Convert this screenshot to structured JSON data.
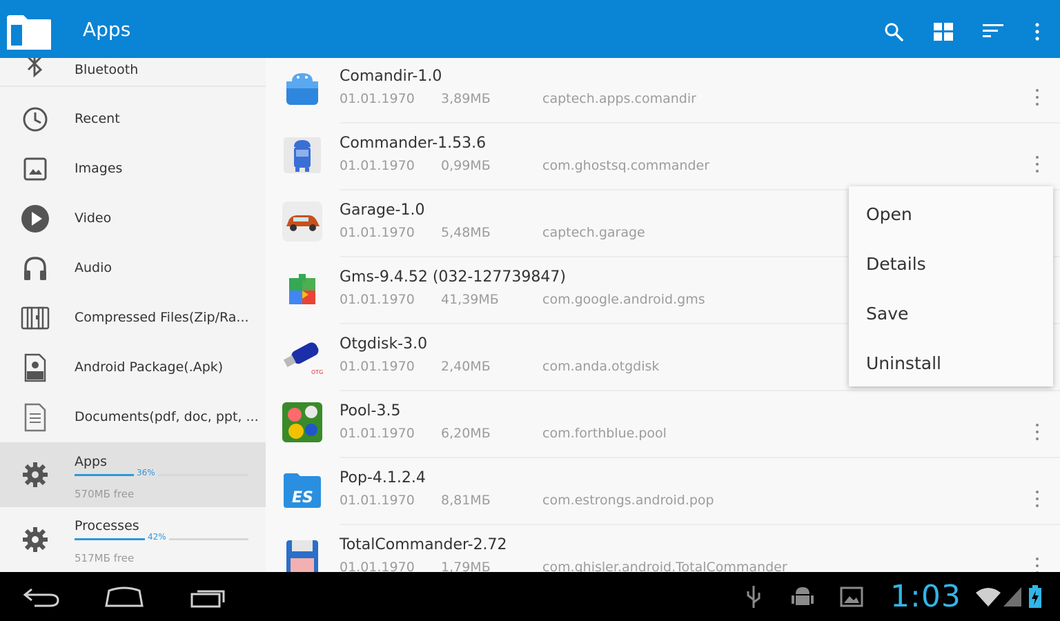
{
  "appbar": {
    "title": "Apps",
    "actions": [
      "search-icon",
      "grid-view-icon",
      "sort-icon",
      "overflow-menu-icon"
    ],
    "color": "#0a84d4"
  },
  "sidebar": {
    "items": [
      {
        "label": "Bluetooth",
        "icon": "bluetooth-icon"
      },
      {
        "label": "Recent",
        "icon": "clock-icon"
      },
      {
        "label": "Images",
        "icon": "image-icon"
      },
      {
        "label": "Video",
        "icon": "play-icon"
      },
      {
        "label": "Audio",
        "icon": "headphones-icon"
      },
      {
        "label": "Compressed Files(Zip/Ra...",
        "icon": "archive-icon"
      },
      {
        "label": "Android Package(.Apk)",
        "icon": "apk-file-icon"
      },
      {
        "label": "Documents(pdf, doc, ppt, ...",
        "icon": "document-icon"
      },
      {
        "label": "Apps",
        "icon": "gear-icon",
        "usage_percent": "36%",
        "usage_value": 0.36,
        "free": "570МБ free",
        "selected": true
      },
      {
        "label": "Processes",
        "icon": "gear-icon",
        "usage_percent": "42%",
        "usage_value": 0.42,
        "free": "517МБ free"
      }
    ]
  },
  "apps": [
    {
      "name": "Comandir-1.0",
      "date": "01.01.1970",
      "size": "3,89МБ",
      "package": "captech.apps.comandir",
      "icon": "comandir-app-icon"
    },
    {
      "name": "Commander-1.53.6",
      "date": "01.01.1970",
      "size": "0,99МБ",
      "package": "com.ghostsq.commander",
      "icon": "commander-app-icon"
    },
    {
      "name": "Garage-1.0",
      "date": "01.01.1970",
      "size": "5,48МБ",
      "package": "captech.garage",
      "icon": "garage-app-icon"
    },
    {
      "name": "Gms-9.4.52 (032-127739847)",
      "date": "01.01.1970",
      "size": "41,39МБ",
      "package": "com.google.android.gms",
      "icon": "gms-app-icon"
    },
    {
      "name": "Otgdisk-3.0",
      "date": "01.01.1970",
      "size": "2,40МБ",
      "package": "com.anda.otgdisk",
      "icon": "otgdisk-app-icon"
    },
    {
      "name": "Pool-3.5",
      "date": "01.01.1970",
      "size": "6,20МБ",
      "package": "com.forthblue.pool",
      "icon": "pool-app-icon"
    },
    {
      "name": "Pop-4.1.2.4",
      "date": "01.01.1970",
      "size": "8,81МБ",
      "package": "com.estrongs.android.pop",
      "icon": "es-app-icon"
    },
    {
      "name": "TotalCommander-2.72",
      "date": "01.01.1970",
      "size": "1,79МБ",
      "package": "com.ghisler.android.TotalCommander",
      "icon": "totalcommander-app-icon"
    }
  ],
  "popup_menu": {
    "items": [
      "Open",
      "Details",
      "Save",
      "Uninstall"
    ]
  },
  "navbar": {
    "buttons": [
      "back-icon",
      "home-icon",
      "recent-apps-icon"
    ],
    "status_icons": [
      "usb-icon",
      "android-debug-icon",
      "screenshot-icon",
      "wifi-icon",
      "signal-icon",
      "battery-icon"
    ],
    "time": "1:03",
    "clock_color": "#33b5e5"
  }
}
